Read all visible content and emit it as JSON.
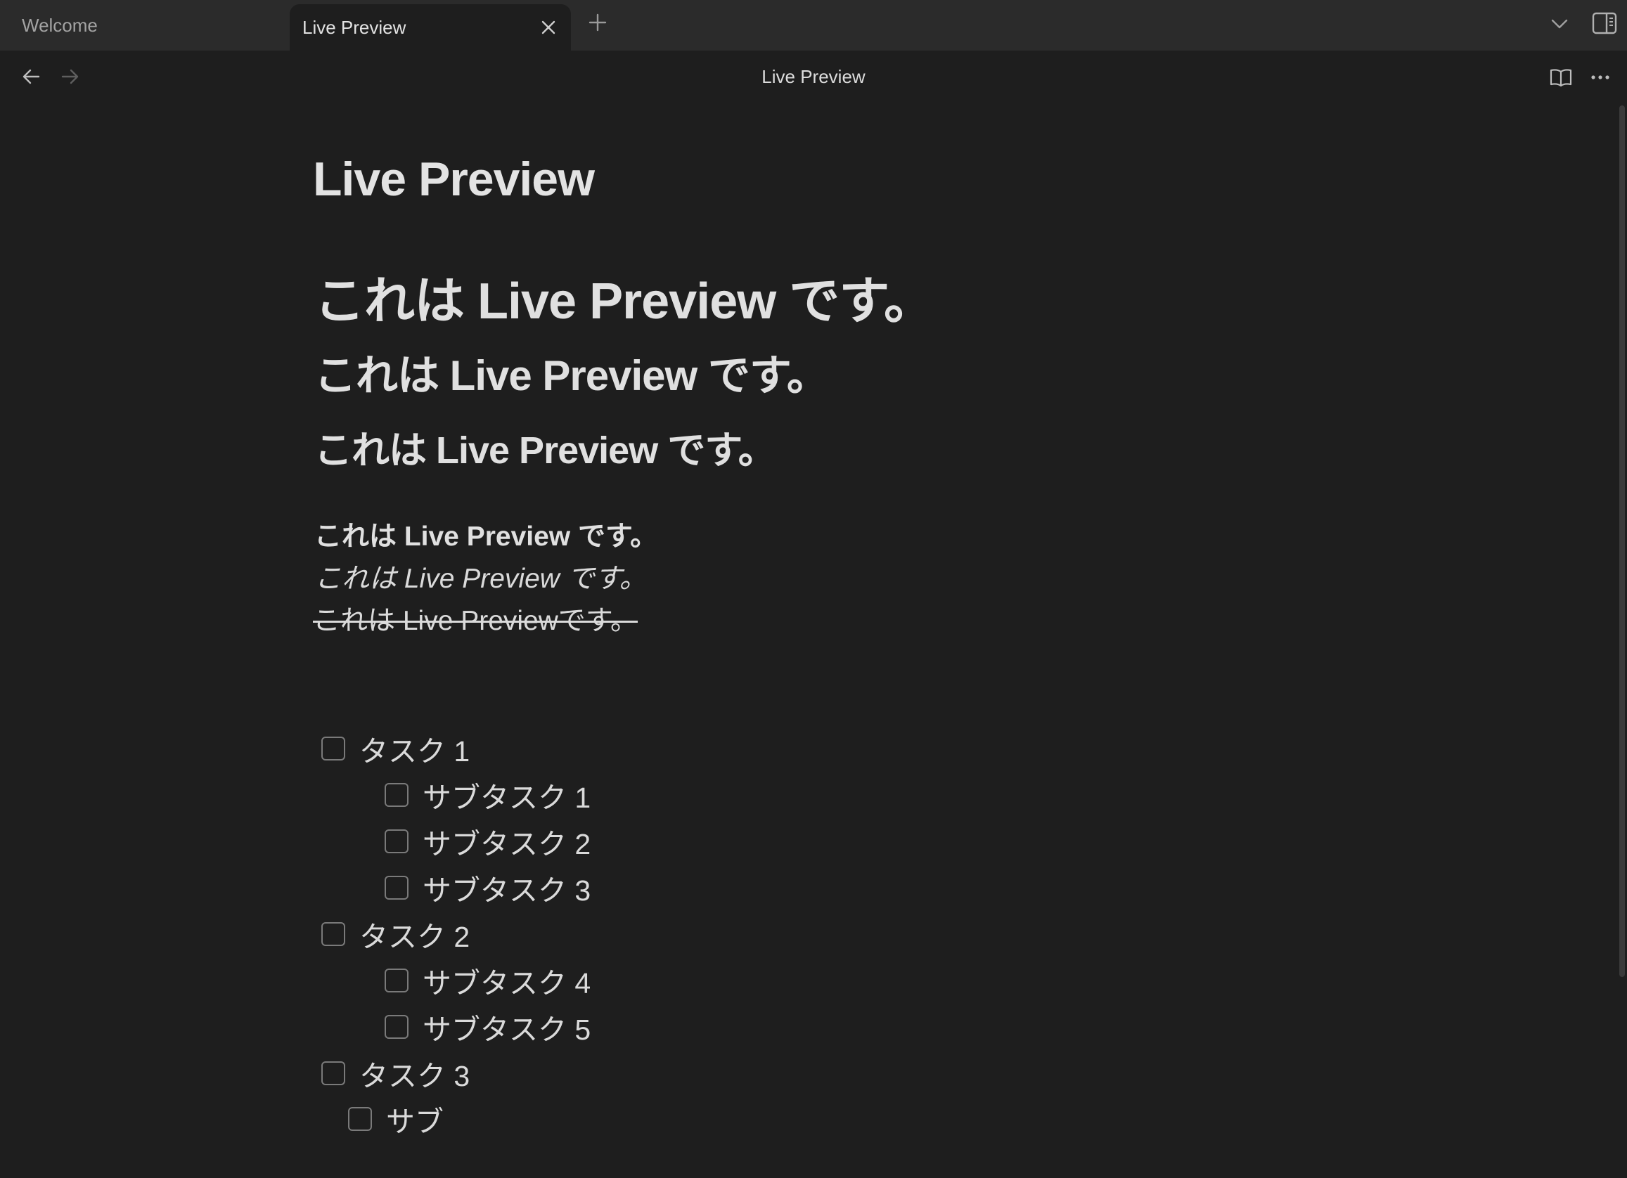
{
  "tabs": [
    {
      "label": "Welcome"
    },
    {
      "label": "Live Preview"
    }
  ],
  "view": {
    "title": "Live Preview"
  },
  "document": {
    "title": "Live Preview",
    "h1": "これは Live Preview です。",
    "h2": "これは Live Preview です。",
    "h3": "これは Live Preview です。",
    "bold": "これは Live Preview です。",
    "italic": "これは Live Preview  です。",
    "strikethrough": "これは Live Previewです。",
    "tasks": [
      {
        "label": "タスク 1",
        "checked": false
      },
      {
        "label": "サブタスク 1",
        "checked": false
      },
      {
        "label": "サブタスク 2",
        "checked": false
      },
      {
        "label": "サブタスク 3",
        "checked": false
      },
      {
        "label": "タスク 2",
        "checked": false
      },
      {
        "label": "サブタスク 4",
        "checked": false
      },
      {
        "label": "サブタスク 5",
        "checked": false
      },
      {
        "label": "タスク 3",
        "checked": false
      },
      {
        "label": "サブ",
        "checked": false
      }
    ]
  },
  "icons": {
    "close": "close-icon",
    "new_tab": "plus-icon",
    "tab_list": "chevron-down-icon",
    "sidebar": "sidebar-toggle-icon",
    "back": "arrow-left-icon",
    "forward": "arrow-right-icon",
    "reading": "book-open-icon",
    "more": "more-horizontal-icon"
  },
  "colors": {
    "background": "#1e1e1e",
    "tabbar": "#2b2b2b",
    "text": "#dadada",
    "muted": "#a3a3a3"
  }
}
